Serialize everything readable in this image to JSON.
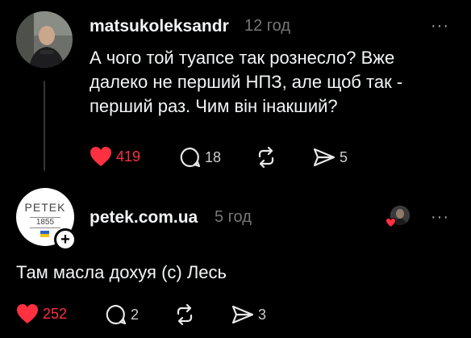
{
  "post1": {
    "username": "matsukoleksandr",
    "time": "12 год",
    "more": "···",
    "text_lines": [
      "А чого той туапсе так рознесло? Вже",
      "далеко не перший НПЗ, але щоб так -",
      "перший раз. Чим він інакший?"
    ],
    "likes": "419",
    "comments": "18",
    "shares": "5"
  },
  "post2": {
    "username": "petek.com.ua",
    "time": "5 год",
    "more": "···",
    "logo_word": "PETEK",
    "logo_year": "1855",
    "follow_plus": "+",
    "text": "Там масла дохуя (с) Лесь",
    "likes": "252",
    "comments": "2",
    "shares": "3"
  },
  "colors": {
    "background": "#000000",
    "like_red": "#ff3040",
    "muted": "#777777",
    "text": "#f3f5f7"
  },
  "icons": [
    "heart-icon",
    "comment-icon",
    "repost-icon",
    "share-icon",
    "more-icon",
    "plus-icon"
  ]
}
